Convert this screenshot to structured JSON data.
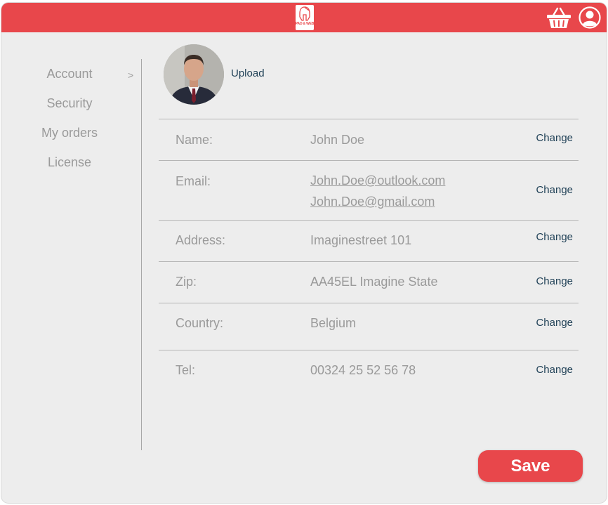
{
  "brand": {
    "logo_text": "PAD & WEB",
    "accent": "#e8474b"
  },
  "header": {
    "basket_icon": "basket-icon",
    "user_icon": "user-icon"
  },
  "sidebar": {
    "items": [
      {
        "label": "Account",
        "active": true,
        "arrow": ">"
      },
      {
        "label": "Security"
      },
      {
        "label": "My orders"
      },
      {
        "label": "License"
      }
    ]
  },
  "profile": {
    "upload_label": "Upload",
    "rows": [
      {
        "label": "Name:",
        "values": [
          "John Doe"
        ],
        "action": "Change"
      },
      {
        "label": "Email:",
        "values": [
          "John.Doe@outlook.com",
          "John.Doe@gmail.com"
        ],
        "action": "Change"
      },
      {
        "label": "Address:",
        "values": [
          "Imaginestreet 101"
        ],
        "action": "Change"
      },
      {
        "label": "Zip:",
        "values": [
          "AA45EL Imagine State"
        ],
        "action": "Change"
      },
      {
        "label": "Country:",
        "values": [
          "Belgium"
        ],
        "action": "Change"
      },
      {
        "label": "Tel:",
        "values": [
          "00324 25 52 56 78"
        ],
        "action": "Change"
      }
    ]
  },
  "footer": {
    "save_label": "Save"
  }
}
